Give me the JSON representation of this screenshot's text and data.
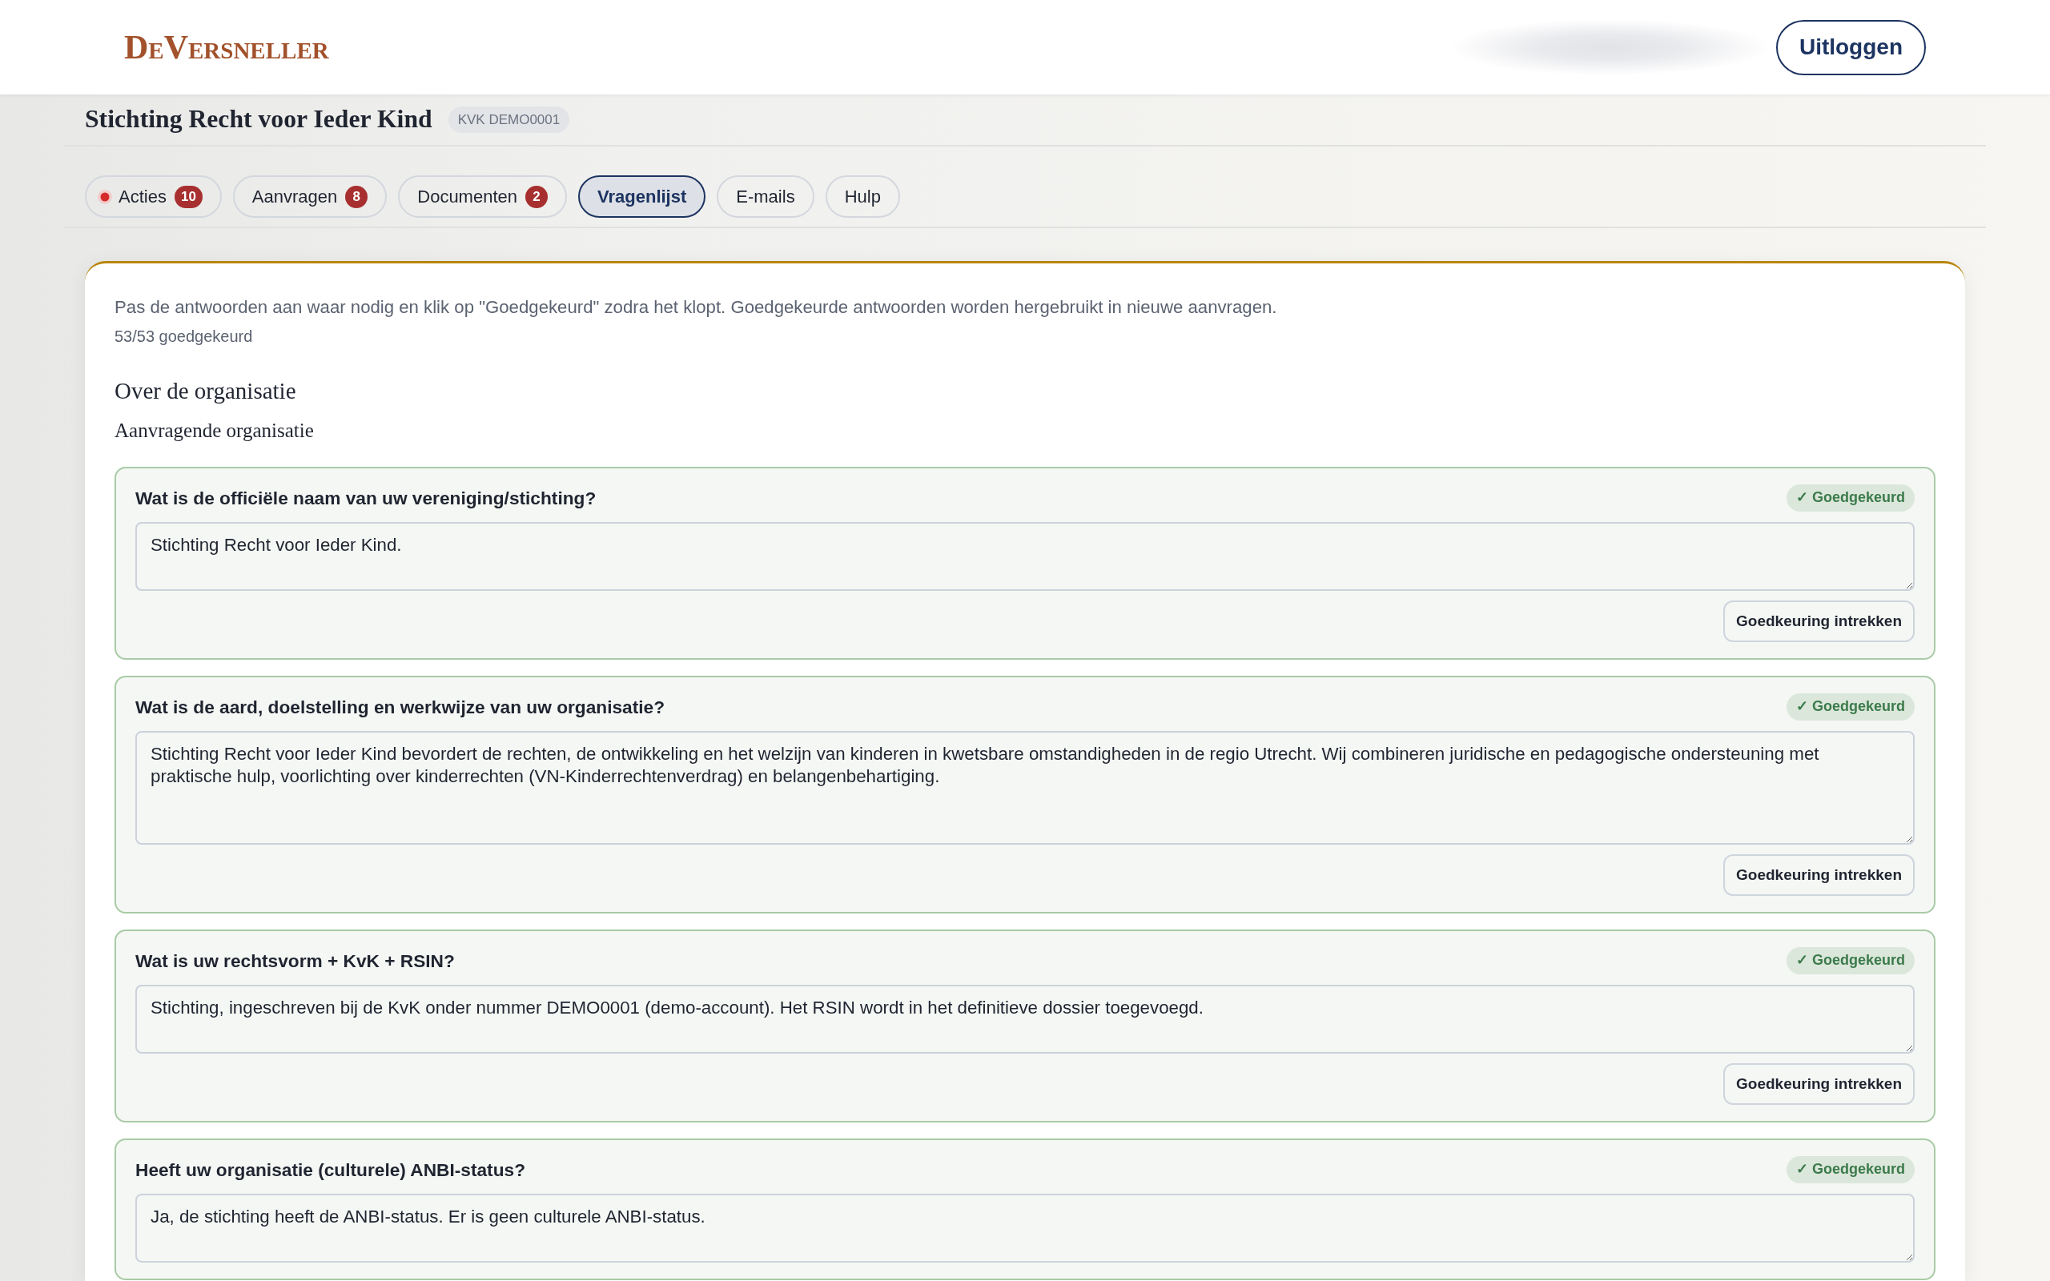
{
  "header": {
    "logo": "DeVersneller",
    "logout_button": "Uitloggen"
  },
  "organization": {
    "name": "Stichting Recht voor Ieder Kind",
    "kvk_badge": "KVK DEMO0001"
  },
  "tabs": [
    {
      "label": "Acties",
      "count": "10",
      "alert": true,
      "selected": false
    },
    {
      "label": "Aanvragen",
      "count": "8",
      "alert": false,
      "selected": false
    },
    {
      "label": "Documenten",
      "count": "2",
      "alert": false,
      "selected": false
    },
    {
      "label": "Vragenlijst",
      "alert": false,
      "selected": true
    },
    {
      "label": "E-mails",
      "alert": false,
      "selected": false
    },
    {
      "label": "Hulp",
      "alert": false,
      "selected": false
    }
  ],
  "questionnaire": {
    "intro": "Pas de antwoorden aan waar nodig en klik op \"Goedgekeurd\" zodra het klopt. Goedgekeurde antwoorden worden hergebruikt in nieuwe aanvragen.",
    "progress": "53/53 goedgekeurd",
    "section": "Over de organisatie",
    "subsection": "Aanvragende organisatie",
    "questions": [
      {
        "question": "Wat is de officiële naam van uw vereniging/stichting?",
        "approved": true,
        "status_label": "✓ Goedgekeurd",
        "answer": "Stichting Recht voor Ieder Kind.",
        "action_label": "Goedkeuring intrekken"
      },
      {
        "question": "Wat is de aard, doelstelling en werkwijze van uw organisatie?",
        "approved": true,
        "status_label": "✓ Goedgekeurd",
        "answer": "Stichting Recht voor Ieder Kind bevordert de rechten, de ontwikkeling en het welzijn van kinderen in kwetsbare omstandigheden in de regio Utrecht. Wij combineren juridische en pedagogische ondersteuning met praktische hulp, voorlichting over kinderrechten (VN-Kinderrechtenverdrag) en belangenbehartiging.",
        "action_label": "Goedkeuring intrekken"
      },
      {
        "question": "Wat is uw rechtsvorm + KvK + RSIN?",
        "approved": true,
        "status_label": "✓ Goedgekeurd",
        "answer": "Stichting, ingeschreven bij de KvK onder nummer DEMO0001 (demo-account). Het RSIN wordt in het definitieve dossier toegevoegd.",
        "action_label": "Goedkeuring intrekken"
      },
      {
        "question": "Heeft uw organisatie (culturele) ANBI-status?",
        "approved": true,
        "status_label": "✓ Goedgekeurd",
        "answer": "Ja, de stichting heeft de ANBI-status. Er is geen culturele ANBI-status."
      }
    ]
  }
}
